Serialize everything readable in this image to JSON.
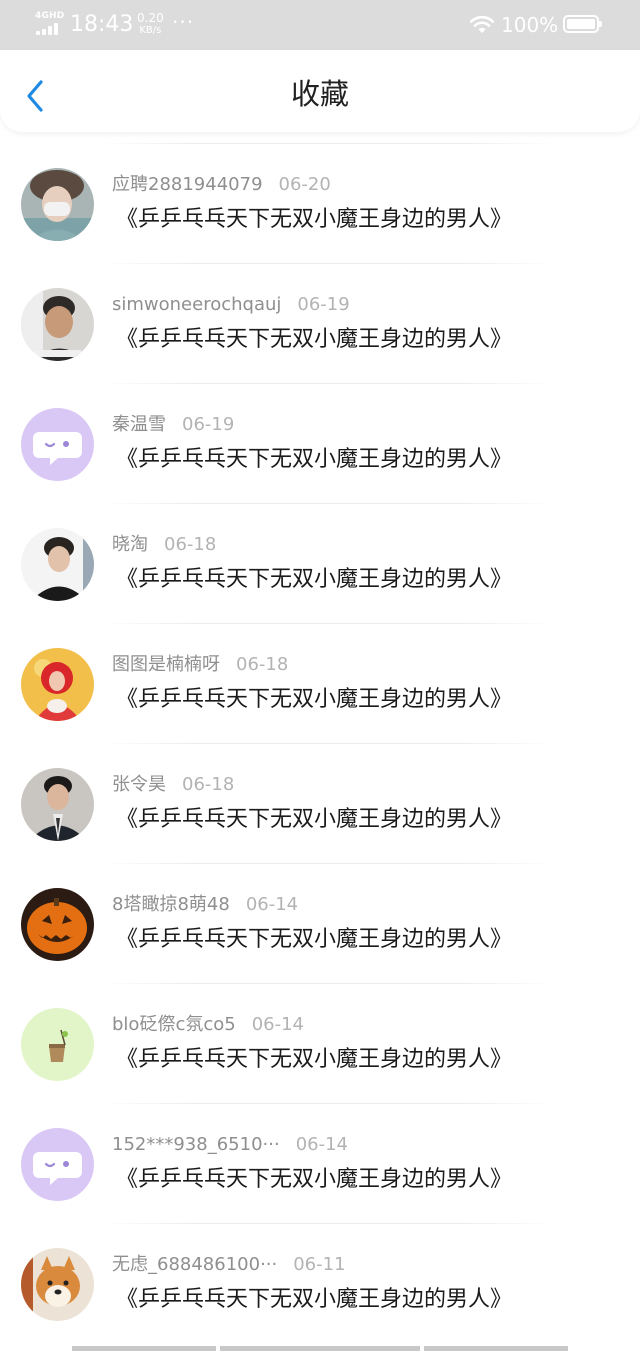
{
  "status_bar": {
    "network": "4GHD",
    "time": "18:43",
    "speed_value": "0.20",
    "speed_unit": "KB/s",
    "more": "···",
    "battery": "100%"
  },
  "header": {
    "title": "收藏",
    "back_icon": "chevron-left-icon"
  },
  "colors": {
    "accent": "#1e88e5",
    "username": "#8f8f8f",
    "date": "#b3b3b3",
    "title_text": "#1a1a1a",
    "status_bar_bg": "#dcdcdc"
  },
  "favorites": [
    {
      "user": "应聘2881944079",
      "date": "06-20",
      "title": "《乒乒乓乓天下无双小魔王身边的男人》",
      "avatar": "photo-girl-mask"
    },
    {
      "user": "simwoneerochqauj",
      "date": "06-19",
      "title": "《乒乒乓乓天下无双小魔王身边的男人》",
      "avatar": "photo-guy"
    },
    {
      "user": "秦温雪",
      "date": "06-19",
      "title": "《乒乒乓乓天下无双小魔王身边的男人》",
      "avatar": "default-chat-bubble"
    },
    {
      "user": "晓淘",
      "date": "06-18",
      "title": "《乒乒乓乓天下无双小魔王身边的男人》",
      "avatar": "photo-young-man"
    },
    {
      "user": "图图是楠楠呀",
      "date": "06-18",
      "title": "《乒乒乓乓天下无双小魔王身边的男人》",
      "avatar": "photo-red-girl"
    },
    {
      "user": "张令昊",
      "date": "06-18",
      "title": "《乒乒乓乓天下无双小魔王身边的男人》",
      "avatar": "photo-man-suit"
    },
    {
      "user": "8塔瞰掠8萌48",
      "date": "06-14",
      "title": "《乒乒乓乓天下无双小魔王身边的男人》",
      "avatar": "photo-pumpkin"
    },
    {
      "user": "blo砭傺c氛co5",
      "date": "06-14",
      "title": "《乒乒乓乓天下无双小魔王身边的男人》",
      "avatar": "drink-green"
    },
    {
      "user": "152***938_6510···",
      "date": "06-14",
      "title": "《乒乒乓乓天下无双小魔王身边的男人》",
      "avatar": "default-chat-bubble"
    },
    {
      "user": "无虑_688486100···",
      "date": "06-11",
      "title": "《乒乒乓乓天下无双小魔王身边的男人》",
      "avatar": "photo-shiba-dog"
    }
  ]
}
